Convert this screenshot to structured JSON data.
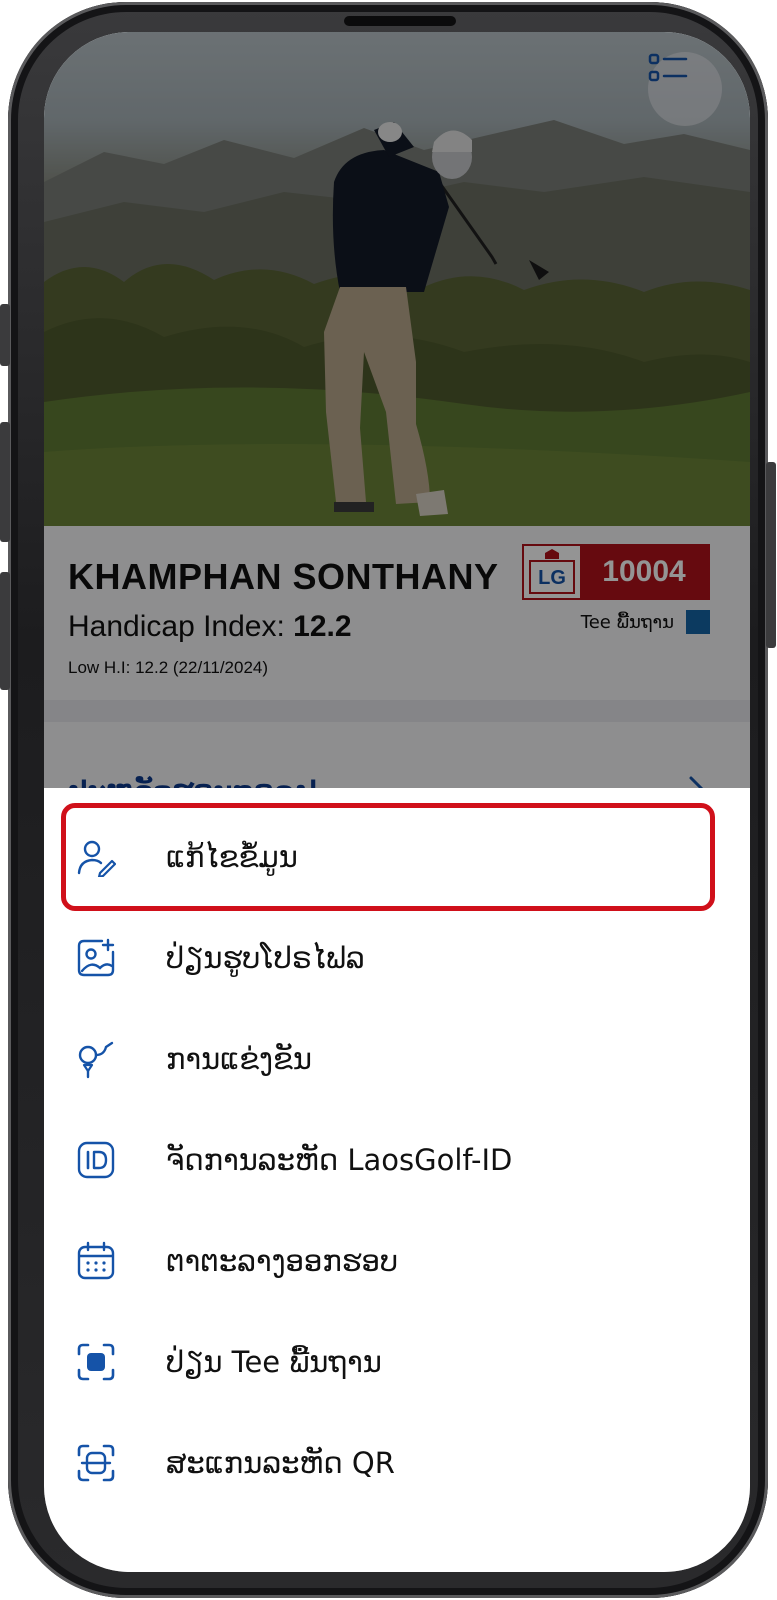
{
  "profile": {
    "name": "KHAMPHAN SONTHANY",
    "handicap_label": "Handicap Index: ",
    "handicap_value": "12.2",
    "low_hi": "Low H.I: 12.2 (22/11/2024)",
    "badge_logo_text": "LG",
    "member_number": "10004",
    "tee_label": "Tee ພື້ນຖານ",
    "tee_color": "#1565a6"
  },
  "history": {
    "title": "ປະຫວັດຮອບກອລຟ"
  },
  "colors": {
    "accent": "#1553a8",
    "highlight": "#d0101a",
    "badge_red": "#b0121a",
    "title_blue": "#0d3a8c"
  },
  "menu": {
    "items": [
      {
        "label": "ແກ້ໄຂຂໍ້ມູນ",
        "icon": "user-edit-icon"
      },
      {
        "label": "ປ່ຽນຮູບໂປຣໄຟລ",
        "icon": "image-user-icon"
      },
      {
        "label": "ການແຂ່ງຂັນ",
        "icon": "golf-tee-icon"
      },
      {
        "label": "ຈັດການລະຫັດ LaosGolf-ID",
        "icon": "id-icon"
      },
      {
        "label": "ຕາຕະລາງອອກຮອບ",
        "icon": "calendar-icon"
      },
      {
        "label": "ປ່ຽນ Tee ພື້ນຖານ",
        "icon": "tee-scan-icon"
      },
      {
        "label": "ສະແກນລະຫັດ QR",
        "icon": "qr-scan-icon"
      }
    ]
  }
}
